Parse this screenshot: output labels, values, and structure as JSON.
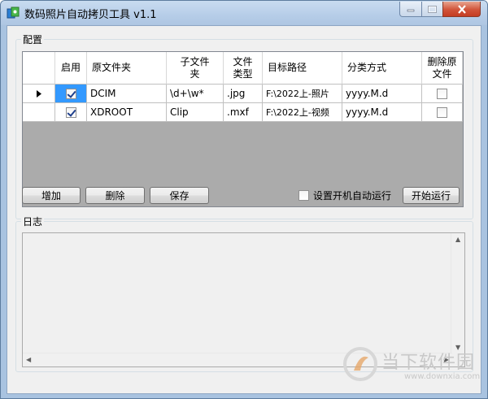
{
  "window": {
    "title": "数码照片自动拷贝工具 v1.1"
  },
  "config_group": {
    "label": "配置",
    "columns": [
      "启用",
      "原文件夹",
      "子文件夹",
      "文件类型",
      "目标路径",
      "分类方式",
      "删除原文件"
    ],
    "rows": [
      {
        "enabled": true,
        "source": "DCIM",
        "subfolder": "\\d+\\w*",
        "filetype": ".jpg",
        "target": "F:\\2022上-照片",
        "classify": "yyyy.M.d",
        "delete": false
      },
      {
        "enabled": true,
        "source": "XDROOT",
        "subfolder": "Clip",
        "filetype": ".mxf",
        "target": "F:\\2022上-视频",
        "classify": "yyyy.M.d",
        "delete": false
      }
    ]
  },
  "buttons": {
    "add": "增加",
    "delete": "删除",
    "save": "保存",
    "start": "开始运行"
  },
  "autostart": {
    "label": "设置开机自动运行",
    "checked": false
  },
  "log_group": {
    "label": "日志"
  },
  "watermark": {
    "text": "当下软件园",
    "url": "www.downxia.com"
  }
}
